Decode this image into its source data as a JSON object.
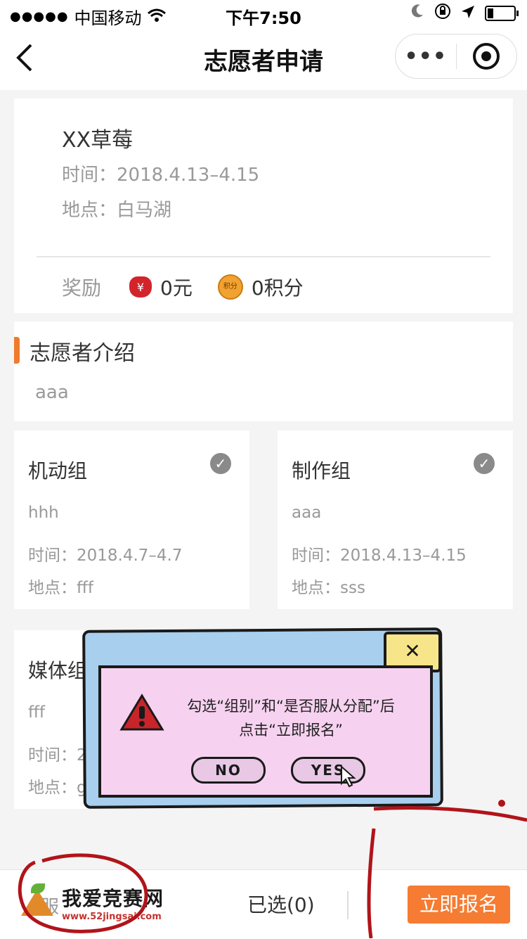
{
  "status_bar": {
    "carrier": "中国移动",
    "time": "下午7:50"
  },
  "nav": {
    "title": "志愿者申请"
  },
  "event": {
    "title": "XX草莓",
    "time": "时间：2018.4.13–4.15",
    "location": "地点：白马湖",
    "reward_label": "奖励",
    "money_icon_text": "¥",
    "money": "0元",
    "coin_icon_text": "积分",
    "points": "0积分"
  },
  "intro": {
    "title": "志愿者介绍",
    "text": "aaa"
  },
  "groups": [
    {
      "name": "机动组",
      "desc": "hhh",
      "time": "时间：2018.4.7–4.7",
      "location": "地点：fff"
    },
    {
      "name": "制作组",
      "desc": "aaa",
      "time": "时间：2018.4.13–4.15",
      "location": "地点：sss"
    },
    {
      "name": "媒体组",
      "desc": "fff",
      "time": "时间：2",
      "location": "地点：g"
    }
  ],
  "bottom_bar": {
    "left_label": "服",
    "selected": "已选(0)",
    "submit": "立即报名"
  },
  "watermark": {
    "title": "我爱竞赛网",
    "url": "www.52jingsai.com"
  },
  "popup": {
    "message_line1": "勾选“组别”和“是否服从分配”后",
    "message_line2": "点击“立即报名”",
    "no": "NO",
    "yes": "YES"
  },
  "colors": {
    "accent": "#f57c32",
    "popup_blue": "#a8cfee",
    "popup_pink": "#f6d2f0",
    "annotation_red": "#b0141a"
  }
}
